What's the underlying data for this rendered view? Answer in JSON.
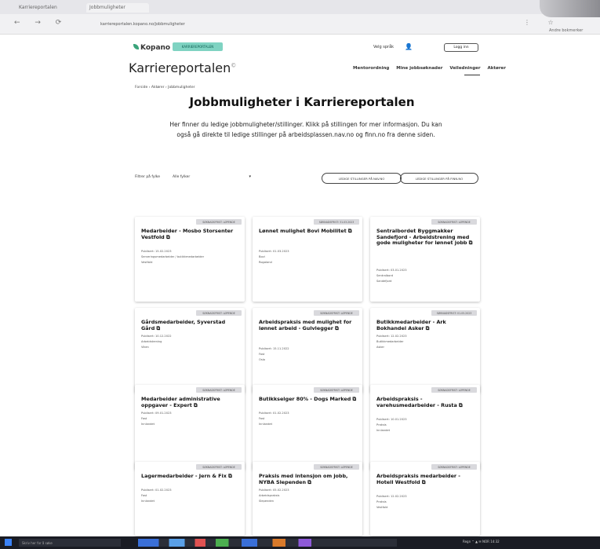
{
  "browser": {
    "tabs": [
      "Karriereportalen",
      "Jobbmuligheter"
    ],
    "nav_glyphs": "← → ⟳",
    "url": "karriereportalen.kopano.no/jobbmuligheter",
    "right_glyphs": "⋮ ☆",
    "sidebar_label": "Andre bokmerker"
  },
  "header": {
    "logo": "Kopano",
    "badge": "KARRIEREPORTALEN",
    "language": "Velg språk",
    "user_glyph": "👤",
    "login": "Logg inn",
    "brand": "Karriereportalen",
    "brand_mark": "©",
    "nav": [
      "Mentorordning",
      "Mine jobbsøknader",
      "Veiledninger",
      "Aktører"
    ]
  },
  "breadcrumb": "Forside › Aktører › Jobbmuligheter",
  "page_title": "Jobbmuligheter i Karriereportalen",
  "intro": "Her finner du ledige jobbmuligheter/stillinger. Klikk på stillingen for mer informasjon. Du kan også gå direkte til ledige stillinger på arbeidsplassen.nav.no og finn.no fra denne siden.",
  "filter": {
    "label": "Filtrer på fylke",
    "value": "Alle fylker",
    "caret": "▾"
  },
  "buttons": {
    "nav": "LEDIGE STILLINGER PÅ NAV.NO",
    "finn": "LEDIGE STILLINGER PÅ FINN.NO"
  },
  "cards": [
    {
      "badge": "SØKNADSFRIST: LØPENDE",
      "title": "Medarbeider - Mosbo Storsenter Vestfold ⧉",
      "meta": [
        "Publisert: 15.02.2023",
        "Serveringsmedarbeider / butikkmedarbeider",
        "Vestfold"
      ]
    },
    {
      "badge": "SØKNADSFRIST: 31.03.2023",
      "title": "Lønnet mulighet Bovi Mobilitet ⧉",
      "meta": [
        "Publisert: 01.03.2023",
        "Bovi",
        "Rogaland"
      ]
    },
    {
      "badge": "SØKNADSFRIST: LØPENDE",
      "title": "Sentralbordet Byggmakker Sandefjord - Arbeidstrening med gode muligheter for lønnet jobb ⧉",
      "meta": [
        "Publisert: 03.01.2023",
        "Sentralbord",
        "Sandefjord"
      ]
    },
    {
      "badge": "SØKNADSFRIST: LØPENDE",
      "title": "Gårdsmedarbeider, Syverstad Gård ⧉",
      "meta": [
        "Publisert: 10.12.2022",
        "Arbeidstrening",
        "Viken"
      ]
    },
    {
      "badge": "SØKNADSFRIST: LØPENDE",
      "title": "Arbeidspraksis med mulighet for lønnet arbeid - Gulvlegger ⧉",
      "meta": [
        "Publisert: 15.11.2022",
        "Fast",
        "Oslo"
      ]
    },
    {
      "badge": "SØKNADSFRIST: 01.05.2023",
      "title": "Butikkmedarbeider - Ark Bokhandel Asker ⧉",
      "meta": [
        "Publisert: 12.02.2023",
        "Butikkmedarbeider",
        "Asker"
      ]
    },
    {
      "badge": "SØKNADSFRIST: LØPENDE",
      "title": "Medarbeider administrative oppgaver - Expert ⧉",
      "meta": [
        "Publisert: 09.01.2023",
        "Fast",
        "Innlandet"
      ]
    },
    {
      "badge": "SØKNADSFRIST: LØPENDE",
      "title": "Butikkselger 80% - Dogs Marked ⧉",
      "meta": [
        "Publisert: 01.02.2023",
        "Fast",
        "Innlandet"
      ]
    },
    {
      "badge": "SØKNADSFRIST: LØPENDE",
      "title": "Arbeidspraksis - varehusmedarbeider - Rusta ⧉",
      "meta": [
        "Publisert: 10.01.2023",
        "Praksis",
        "Innlandet"
      ]
    },
    {
      "badge": "SØKNADSFRIST: LØPENDE",
      "title": "Lagermedarbeider - Jern & Fix ⧉",
      "meta": [
        "Publisert: 01.02.2023",
        "Fast",
        "Innlandet"
      ]
    },
    {
      "badge": "SØKNADSFRIST: LØPENDE",
      "title": "Praksis med intensjon om jobb, NYBA Slependen ⧉",
      "meta": [
        "Publisert: 05.02.2023",
        "Arbeidspraksis",
        "Slependen"
      ]
    },
    {
      "badge": "SØKNADSFRIST: LØPENDE",
      "title": "Arbeidspraksis medarbeider - Hotell Westfold ⧉",
      "meta": [
        "Publisert: 12.02.2023",
        "Praksis",
        "Vestfold"
      ]
    }
  ],
  "taskbar": {
    "search": "Skriv her for å søke",
    "tray": "Regn ⌃ ▲ ✉ NOR 14:32"
  }
}
